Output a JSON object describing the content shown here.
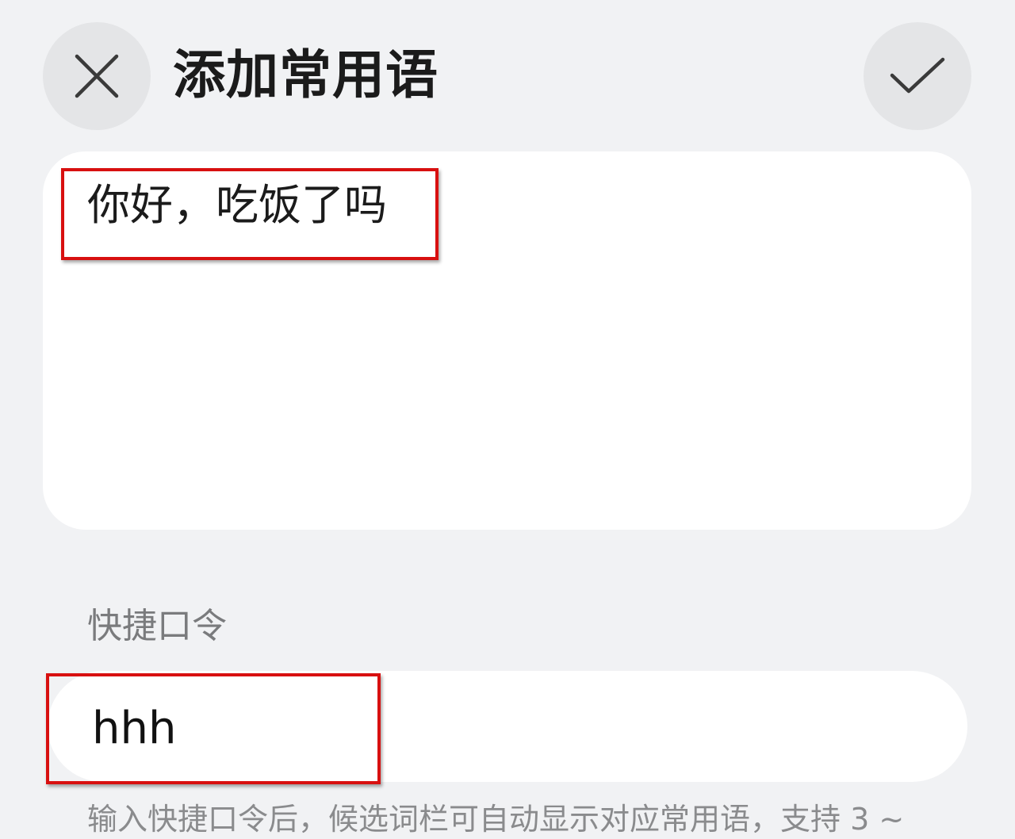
{
  "header": {
    "close_icon": "close-icon",
    "title": "添加常用语",
    "confirm_icon": "check-icon"
  },
  "phrase": {
    "content": "你好，吃饭了吗"
  },
  "shortcut": {
    "label": "快捷口令",
    "value": "hhh",
    "hint": "输入快捷口令后，候选词栏可自动显示对应常用语，支持 3 ~"
  },
  "colors": {
    "background": "#f1f2f4",
    "button_bg": "#e4e5e7",
    "highlight": "#d81010"
  }
}
